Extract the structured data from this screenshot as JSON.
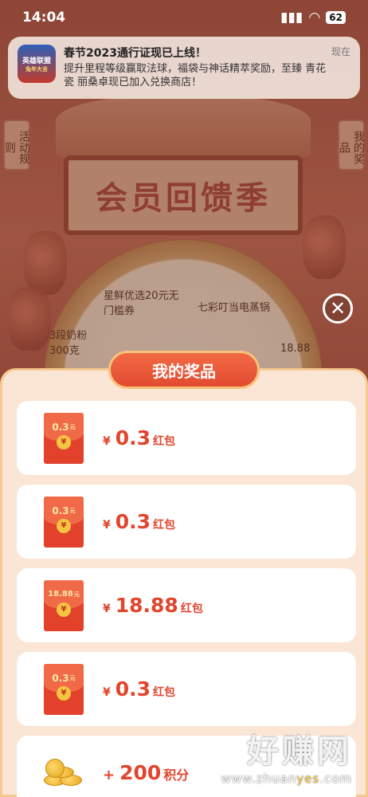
{
  "status_bar": {
    "time": "14:04",
    "battery": "62"
  },
  "notification": {
    "app_icon_line1": "英雄联盟",
    "app_icon_line2": "兔年大吉",
    "title": "春节2023通行证现已上线！",
    "body": "提升里程等级赢取法球，福袋与神话精萃奖励，至臻 青花瓷 丽桑卓现已加入兑换商店！",
    "time": "现在"
  },
  "background": {
    "board_title": "会员回馈季",
    "left_tab": "活动规则",
    "right_tab": "我的奖品",
    "wheel_items": [
      "星鲜优选20元无门槛券",
      "七彩叮当电蒸锅",
      "3段奶粉300克",
      "18.88"
    ]
  },
  "panel": {
    "title": "我的奖品",
    "prizes": [
      {
        "badge": "0.3",
        "badge_unit": "元",
        "currency": "¥",
        "amount": "0.3",
        "unit": "红包",
        "kind": "envelope"
      },
      {
        "badge": "0.3",
        "badge_unit": "元",
        "currency": "¥",
        "amount": "0.3",
        "unit": "红包",
        "kind": "envelope"
      },
      {
        "badge": "18.88",
        "badge_unit": "元",
        "currency": "¥",
        "amount": "18.88",
        "unit": "红包",
        "kind": "envelope"
      },
      {
        "badge": "0.3",
        "badge_unit": "元",
        "currency": "¥",
        "amount": "0.3",
        "unit": "红包",
        "kind": "envelope"
      },
      {
        "currency": "+",
        "amount": "200",
        "unit": "积分",
        "kind": "coins"
      }
    ]
  },
  "coin_glyph": "¥",
  "watermark": {
    "big": "好赚网",
    "small_pre": "www.zhuan",
    "small_hl": "yes",
    "small_post": ".com"
  }
}
